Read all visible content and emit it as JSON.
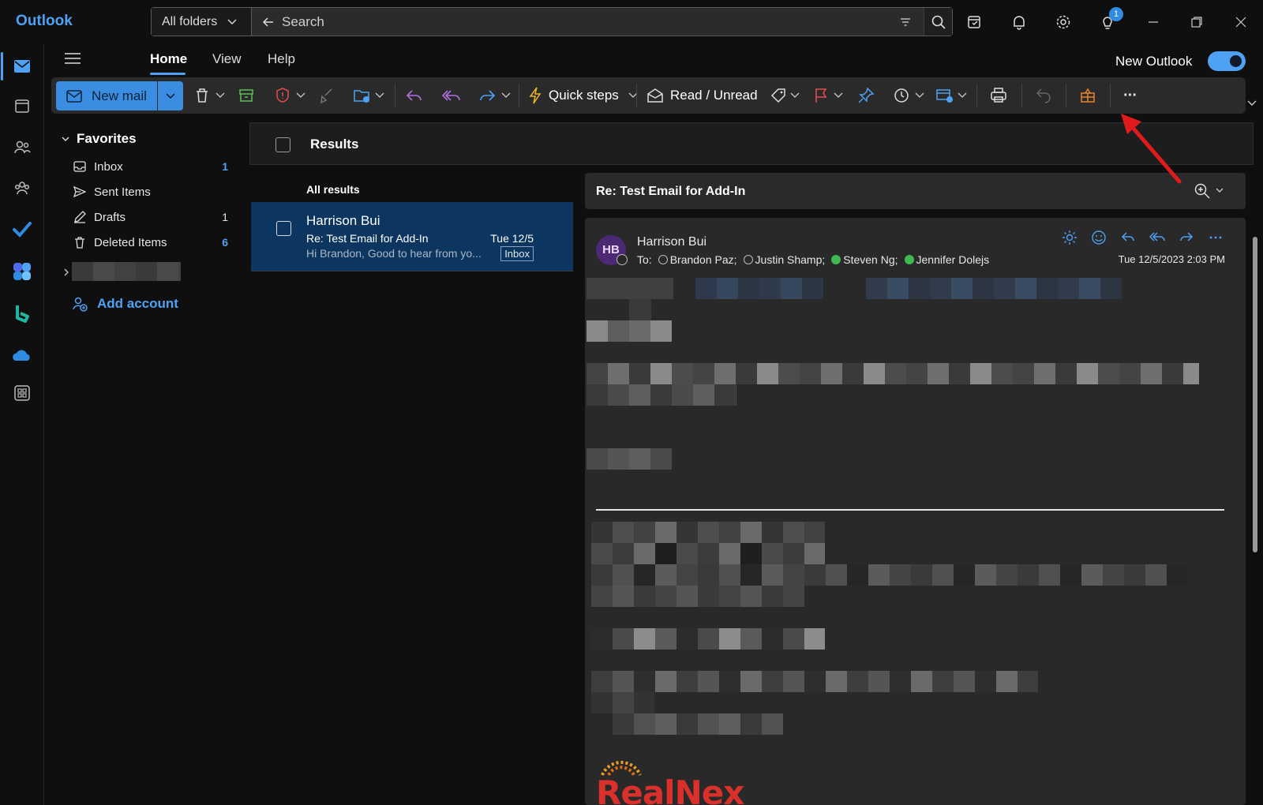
{
  "app": {
    "title": "Outlook"
  },
  "search": {
    "folder": "All folders",
    "placeholder": "Search"
  },
  "titlebar": {
    "notification_badge": "1"
  },
  "menu": {
    "tabs": [
      {
        "label": "Home",
        "active": true
      },
      {
        "label": "View",
        "active": false
      },
      {
        "label": "Help",
        "active": false
      }
    ],
    "new_outlook_label": "New Outlook",
    "new_outlook_enabled": true
  },
  "ribbon": {
    "new_mail": "New mail",
    "quick_steps": "Quick steps",
    "read_unread": "Read / Unread",
    "more": "···"
  },
  "folders": {
    "favorites_label": "Favorites",
    "items": [
      {
        "label": "Inbox",
        "count": "1",
        "highlight": true
      },
      {
        "label": "Sent Items",
        "count": "",
        "highlight": false
      },
      {
        "label": "Drafts",
        "count": "1",
        "highlight": false
      },
      {
        "label": "Deleted Items",
        "count": "6",
        "highlight": true
      }
    ],
    "add_account": "Add account"
  },
  "list": {
    "header": "Results",
    "section": "All results",
    "messages": [
      {
        "sender": "Harrison Bui",
        "subject": "Re: Test Email for Add-In",
        "date": "Tue 12/5",
        "preview": "Hi Brandon, Good to hear from yo...",
        "folder_tag": "Inbox",
        "selected": true
      }
    ]
  },
  "reading": {
    "subject": "Re: Test Email for Add-In",
    "sender_initials": "HB",
    "sender_name": "Harrison Bui",
    "to_label": "To:",
    "recipients": [
      {
        "name": "Brandon Paz;",
        "status": "unknown"
      },
      {
        "name": "Justin Shamp;",
        "status": "unknown"
      },
      {
        "name": "Steven Ng;",
        "status": "available"
      },
      {
        "name": "Jennifer Dolejs",
        "status": "available"
      }
    ],
    "sent_time": "Tue 12/5/2023 2:03 PM",
    "signature_logo": "RealNex"
  },
  "colors": {
    "accent": "#4ea1f3",
    "selected_row": "#0c3560",
    "flag": "#e04c4c",
    "arrow": "#e01b1b"
  }
}
